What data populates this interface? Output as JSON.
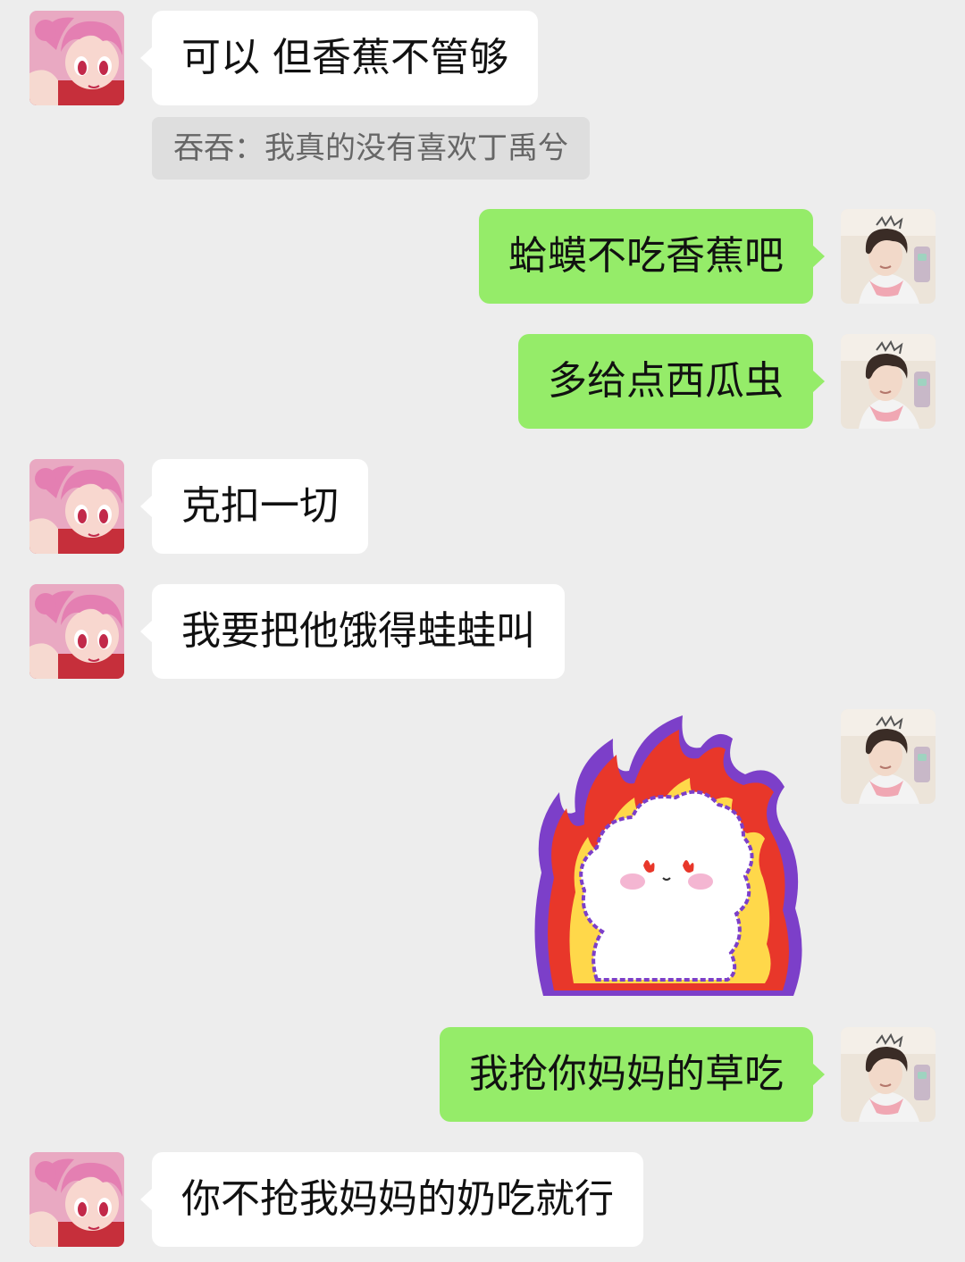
{
  "chat": {
    "messages": [
      {
        "side": "left",
        "text": "可以 但香蕉不管够"
      },
      {
        "type": "quote",
        "text": "吞吞：我真的没有喜欢丁禹兮"
      },
      {
        "side": "right",
        "text": "蛤蟆不吃香蕉吧"
      },
      {
        "side": "right",
        "text": "多给点西瓜虫"
      },
      {
        "side": "left",
        "text": "克扣一切"
      },
      {
        "side": "left",
        "text": "我要把他饿得蛙蛙叫"
      },
      {
        "side": "right",
        "type": "sticker",
        "icon": "flaming-angry-bunny-sticker"
      },
      {
        "side": "right",
        "text": "我抢你妈妈的草吃"
      },
      {
        "side": "left",
        "text": "你不抢我妈妈的奶吃就行"
      }
    ]
  },
  "colors": {
    "background": "#ededed",
    "incoming_bubble": "#ffffff",
    "outgoing_bubble": "#95ec69",
    "quote_bg": "#dedede",
    "quote_text": "#666666"
  },
  "avatars": {
    "contact": "pink-haired-anime-girl-avatar",
    "self": "short-haired-person-avatar"
  }
}
